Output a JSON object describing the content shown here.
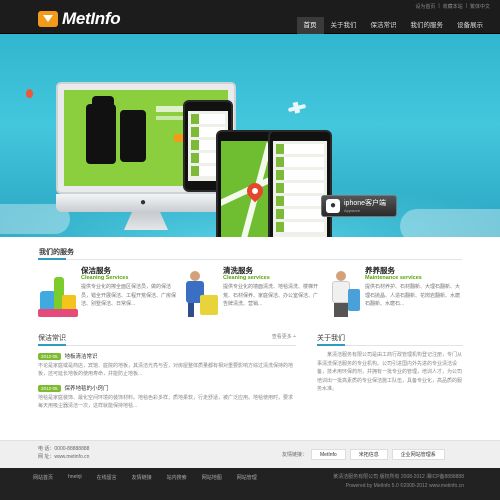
{
  "header": {
    "logo_text": "MetInfo",
    "top_links": [
      "设为首页",
      "|",
      "收藏本站",
      "|",
      "繁体中文"
    ],
    "nav": [
      "首页",
      "关于我们",
      "保洁常识",
      "我们的服务",
      "设备展示"
    ]
  },
  "banner": {
    "app_button_title": "iphone客户端",
    "app_button_sub": "Appstore",
    "slide_count": 5,
    "active_slide": 5
  },
  "services": {
    "title": "我们的服务",
    "items": [
      {
        "title": "保洁服务",
        "subtitle": "Cleaning Services",
        "desc": "提供专业化的擦全面区保洁员，做的保洁员，错全开展保洁、工程开荒保洁、广房保洁、别墅保洁、日常保..."
      },
      {
        "title": "清洗服务",
        "subtitle": "Cleaning services",
        "desc": "提供专业化的墙面清洗、地毯清洗、楼梯开荒、石材保养、家庭保洁、办公室保洁、广告牌清洗、营销..."
      },
      {
        "title": "养养服务",
        "subtitle": "Maintenance services",
        "desc": "提供石材养护、石材翻新、大理石翻新、大理石抛晶、人造石翻新、花岗岩翻新、水磨石翻新、水磨石..."
      }
    ]
  },
  "news": {
    "title": "保洁常识",
    "more": "查看更多 +",
    "items": [
      {
        "date": "2012-05",
        "title": "地板清洁常识",
        "desc": "不论是家庭或是商店，宾馆、庭院的地板，其清洁光亮与否，对房屋整体质量都有相对重要影响方综过清洗保持的地板，还可延长地板的使用寿命，并能防止地板..."
      },
      {
        "date": "2012-05",
        "title": "保养地毯的小窍门",
        "desc": "地毯是家庭装饰、最化空间环境的装饰材料。地毯色彩多样，质地柔软，行走舒适，被广泛应用。地毯使用时，要求每天用吸尘器清洁一次，这样就能保持地毯..."
      }
    ]
  },
  "about": {
    "title": "关于我们",
    "text": "某清洁服务有限公司是由工商行政管理机构登记注册，专门从事清洗保洁服务的专业机构。公司引进国内外先进的专业清洁设备，技术用环保药剂，并拥有一批专业的管理，培训人才，为公司培训出一批高素质的专业保洁施工队伍，具备专业化，高品质的服务水准。"
  },
  "linkbar": {
    "contact_phone": "电    话：0000-88888888",
    "contact_web": "网    址：www.metinfo.cn",
    "friend_label": "友情链接：",
    "friend_links": [
      "MetInfo",
      "米拓信息",
      "企业网站管理系"
    ]
  },
  "footer": {
    "nav": [
      "网站首页",
      "hnetrji",
      "在线留言",
      "友情链接",
      "站内搜索",
      "网站地图",
      "网站管理"
    ],
    "copyright": "某清洁服务有限公司 版权所有 2008-2012 湘ICP备8888888",
    "powered": "Powered by MetInfo 5.0 ©2008-2012 www.metinfo.cn"
  }
}
